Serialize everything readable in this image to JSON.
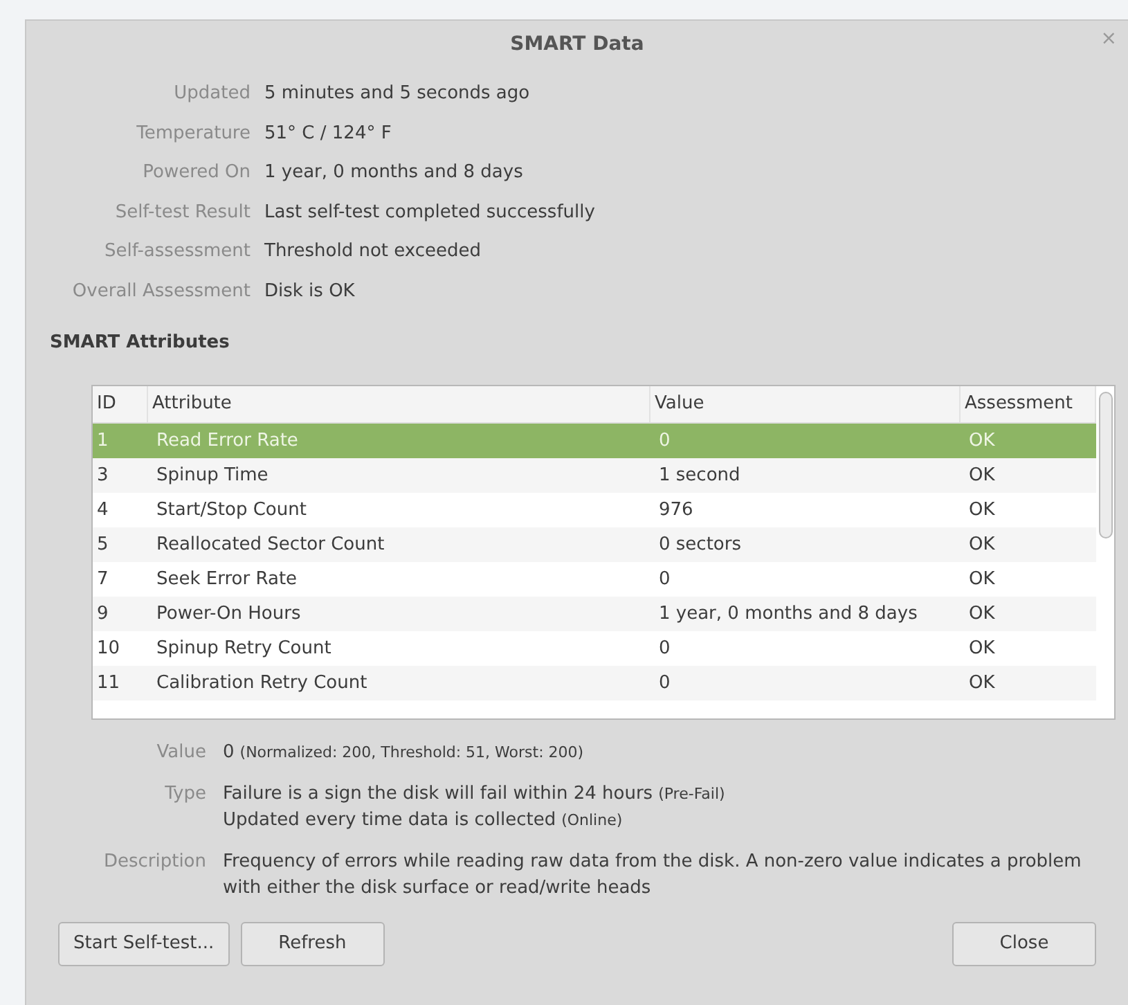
{
  "window": {
    "title": "SMART Data",
    "close": "×"
  },
  "info": [
    {
      "label": "Updated",
      "value": "5 minutes and 5 seconds ago"
    },
    {
      "label": "Temperature",
      "value": "51° C / 124° F"
    },
    {
      "label": "Powered On",
      "value": "1 year, 0 months and 8 days"
    },
    {
      "label": "Self-test Result",
      "value": "Last self-test completed successfully"
    },
    {
      "label": "Self-assessment",
      "value": "Threshold not exceeded"
    },
    {
      "label": "Overall Assessment",
      "value": "Disk is OK"
    }
  ],
  "section_title": "SMART Attributes",
  "table": {
    "columns": [
      "ID",
      "Attribute",
      "Value",
      "Assessment"
    ],
    "rows": [
      {
        "cells": [
          "1",
          "Read Error Rate",
          "0",
          "OK"
        ],
        "selected": true
      },
      {
        "cells": [
          "3",
          "Spinup Time",
          "1 second",
          "OK"
        ],
        "selected": false
      },
      {
        "cells": [
          "4",
          "Start/Stop Count",
          "976",
          "OK"
        ],
        "selected": false
      },
      {
        "cells": [
          "5",
          "Reallocated Sector Count",
          "0 sectors",
          "OK"
        ],
        "selected": false
      },
      {
        "cells": [
          "7",
          "Seek Error Rate",
          "0",
          "OK"
        ],
        "selected": false
      },
      {
        "cells": [
          "9",
          "Power-On Hours",
          "1 year, 0 months and 8 days",
          "OK"
        ],
        "selected": false
      },
      {
        "cells": [
          "10",
          "Spinup Retry Count",
          "0",
          "OK"
        ],
        "selected": false
      },
      {
        "cells": [
          "11",
          "Calibration Retry Count",
          "0",
          "OK"
        ],
        "selected": false
      }
    ]
  },
  "details": [
    {
      "label": "Value",
      "lines": [
        {
          "text": "0",
          "note": "(Normalized: 200, Threshold: 51, Worst: 200)"
        }
      ]
    },
    {
      "label": "Type",
      "lines": [
        {
          "text": "Failure is a sign the disk will fail within 24 hours",
          "note": "(Pre-Fail)"
        },
        {
          "text": "Updated every time data is collected",
          "note": "(Online)"
        }
      ]
    },
    {
      "label": "Description",
      "lines": [
        {
          "text": "Frequency of errors while reading raw data from the disk. A non-zero value indicates a problem with either the disk surface or read/write heads"
        }
      ]
    }
  ],
  "buttons": {
    "left": [
      "Start Self-test...",
      "Refresh"
    ],
    "right": [
      "Close"
    ]
  }
}
